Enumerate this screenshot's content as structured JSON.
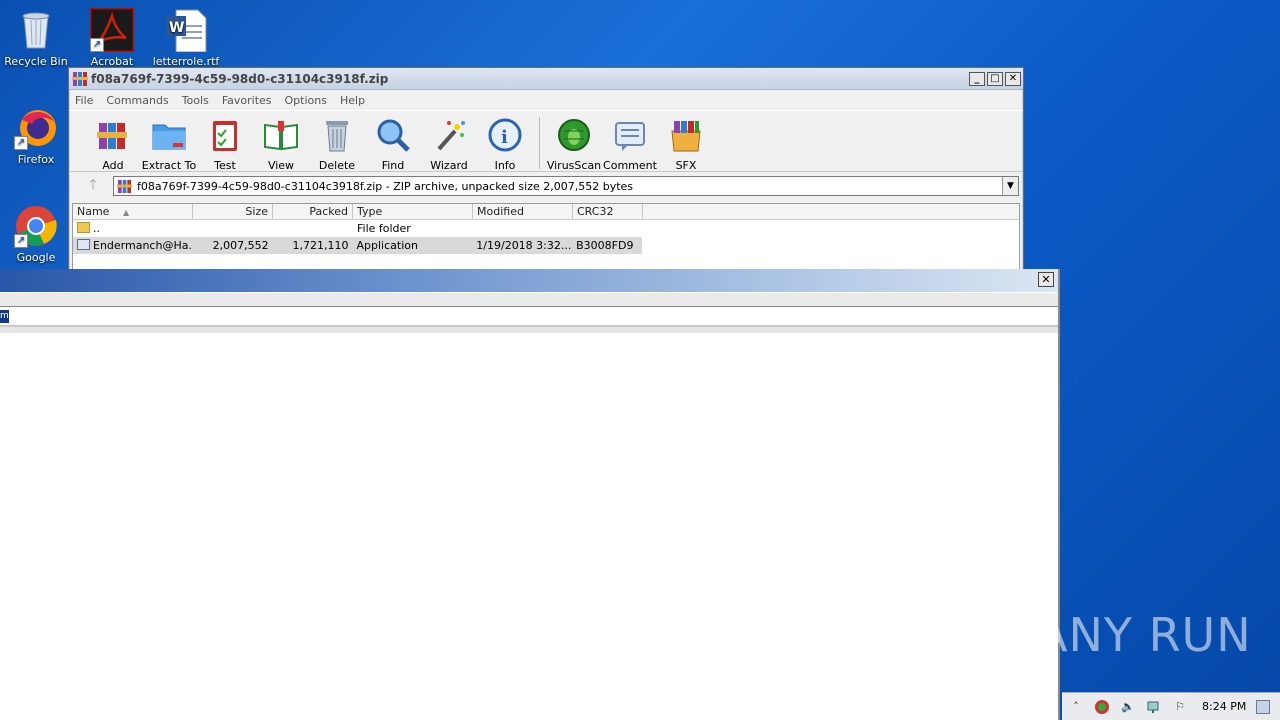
{
  "desktop": {
    "icons": [
      {
        "label": "Recycle Bin"
      },
      {
        "label": "Acrobat"
      },
      {
        "label": "letterrole.rtf"
      },
      {
        "label": "Firefox"
      },
      {
        "label": "Google"
      }
    ]
  },
  "winrar": {
    "title": "f08a769f-7399-4c59-98d0-c31104c3918f.zip",
    "menu": [
      "File",
      "Commands",
      "Tools",
      "Favorites",
      "Options",
      "Help"
    ],
    "toolbar": [
      "Add",
      "Extract To",
      "Test",
      "View",
      "Delete",
      "Find",
      "Wizard",
      "Info",
      "VirusScan",
      "Comment",
      "SFX"
    ],
    "address": "f08a769f-7399-4c59-98d0-c31104c3918f.zip - ZIP archive, unpacked size 2,007,552 bytes",
    "columns": [
      "Name",
      "Size",
      "Packed",
      "Type",
      "Modified",
      "CRC32"
    ],
    "rows": [
      {
        "name": "..",
        "size": "",
        "packed": "",
        "type": "File folder",
        "modified": "",
        "crc": ""
      },
      {
        "name": "Endermanch@Ha...",
        "size": "2,007,552",
        "packed": "1,721,110",
        "type": "Application",
        "modified": "1/19/2018 3:32...",
        "crc": "B3008FD9"
      }
    ]
  },
  "window2": {
    "close": "✕",
    "edit_glyph": "ml"
  },
  "tray": {
    "time": "8:24 PM"
  },
  "watermark": "ANY RUN"
}
